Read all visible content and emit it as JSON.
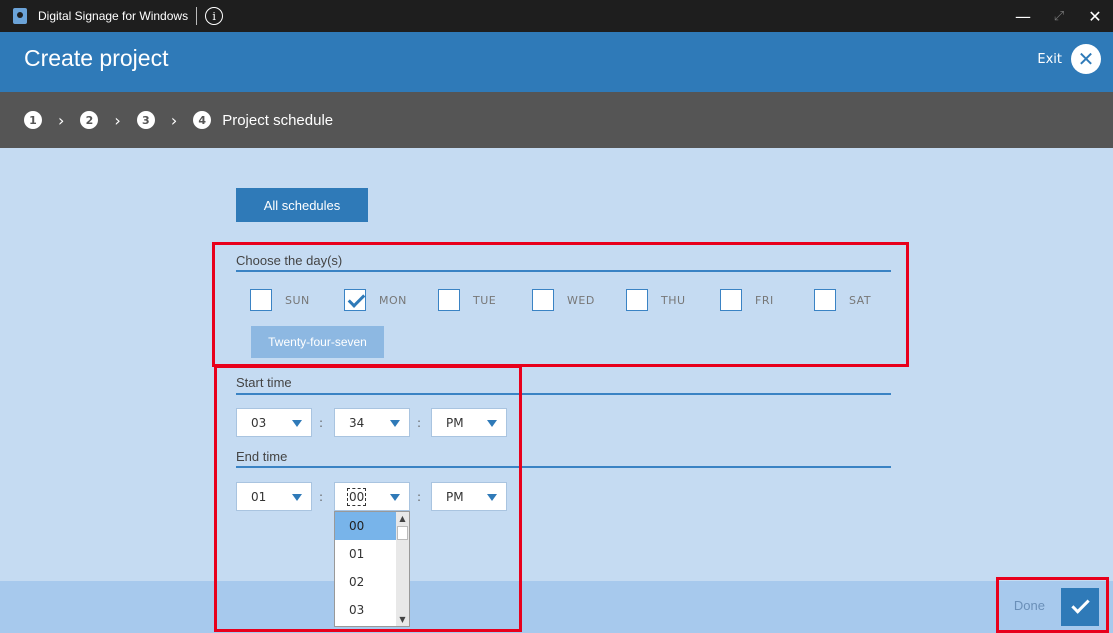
{
  "window": {
    "title": "Digital Signage for Windows",
    "info_icon": "i",
    "minimize_icon": "—",
    "maximize_icon": "⤢",
    "close_icon": "✕"
  },
  "header": {
    "title": "Create project",
    "exit_label": "Exit",
    "exit_icon": "✕"
  },
  "steps": {
    "items": [
      {
        "num": "1"
      },
      {
        "num": "2"
      },
      {
        "num": "3"
      },
      {
        "num": "4",
        "label": "Project schedule"
      }
    ],
    "arrow": "›"
  },
  "content": {
    "all_schedules_label": "All schedules",
    "choose_days_label": "Choose the day(s)",
    "days": [
      {
        "label": "SUN",
        "checked": false
      },
      {
        "label": "MON",
        "checked": true
      },
      {
        "label": "TUE",
        "checked": false
      },
      {
        "label": "WED",
        "checked": false
      },
      {
        "label": "THU",
        "checked": false
      },
      {
        "label": "FRI",
        "checked": false
      },
      {
        "label": "SAT",
        "checked": false
      }
    ],
    "twenty_four_seven_label": "Twenty-four-seven",
    "start_time_label": "Start time",
    "end_time_label": "End time",
    "start": {
      "hour": "03",
      "minute": "34",
      "ampm": "PM"
    },
    "end": {
      "hour": "01",
      "minute": "00",
      "ampm": "PM"
    },
    "colon": ":",
    "minute_dropdown": {
      "options": [
        "00",
        "01",
        "02",
        "03"
      ],
      "selected": "00",
      "scroll_up": "▲",
      "scroll_down": "▼"
    }
  },
  "footer": {
    "done_label": "Done"
  },
  "colors": {
    "accent": "#2f7ab8",
    "highlight": "#e8001c",
    "background": "#c5dbf2"
  }
}
